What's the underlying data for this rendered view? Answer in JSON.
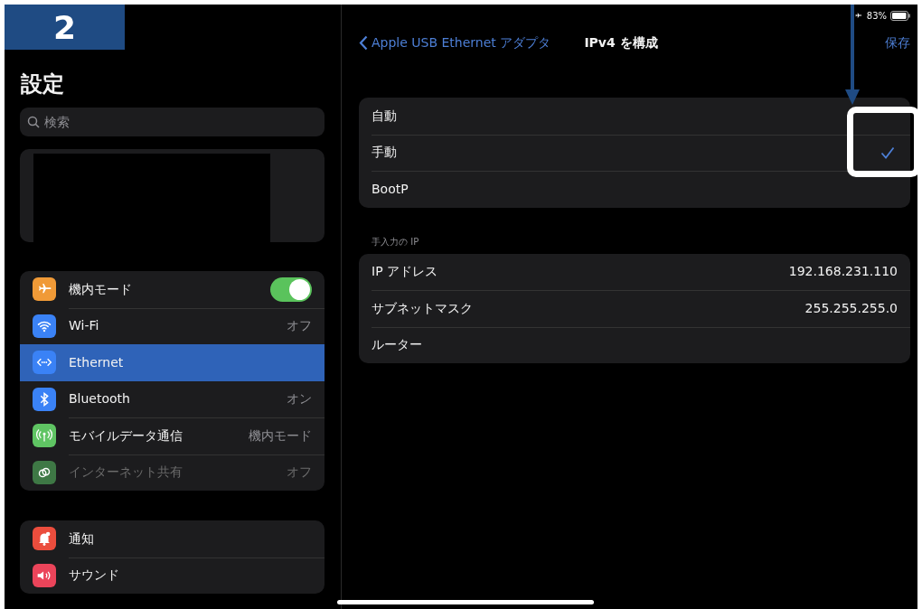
{
  "badge": {
    "text": "2"
  },
  "status_bar": {
    "airplane_mode": true,
    "battery": "83%"
  },
  "sidebar": {
    "title": "設定",
    "search": {
      "placeholder": "検索"
    },
    "groups": [
      {
        "kind": "profile"
      },
      {
        "kind": "list",
        "items": [
          {
            "label": "機内モード",
            "color": "#f09a37",
            "kind": "toggle",
            "on": true,
            "selected": false,
            "disabled": false
          },
          {
            "label": "Wi-Fi",
            "color": "#3a82f6",
            "kind": "value",
            "value": "オフ",
            "selected": false,
            "disabled": false
          },
          {
            "label": "Ethernet",
            "color": "#3a82f6",
            "kind": "plain",
            "selected": true,
            "disabled": false
          },
          {
            "label": "Bluetooth",
            "color": "#3a82f6",
            "kind": "value",
            "value": "オン",
            "selected": false,
            "disabled": false
          },
          {
            "label": "モバイルデータ通信",
            "color": "#5fc463",
            "kind": "value",
            "value": "機内モード",
            "selected": false,
            "disabled": false
          },
          {
            "label": "インターネット共有",
            "color": "#3e7845",
            "kind": "value",
            "value": "オフ",
            "selected": false,
            "disabled": true
          }
        ]
      },
      {
        "kind": "list",
        "items": [
          {
            "label": "通知",
            "color": "#eb4d3d",
            "kind": "plain",
            "selected": false,
            "disabled": false
          },
          {
            "label": "サウンド",
            "color": "#eb445a",
            "kind": "plain",
            "selected": false,
            "disabled": false
          }
        ]
      }
    ]
  },
  "detail": {
    "nav": {
      "back": "Apple USB Ethernet アダプタ",
      "title": "IPv4 を構成",
      "action": "保存"
    },
    "options": [
      {
        "label": "自動",
        "selected": false
      },
      {
        "label": "手動",
        "selected": true
      },
      {
        "label": "BootP",
        "selected": false
      }
    ],
    "manual_section": {
      "header": "手入力の IP",
      "fields": [
        {
          "label": "IP アドレス",
          "value": "192.168.231.110"
        },
        {
          "label": "サブネットマスク",
          "value": "255.255.255.0"
        },
        {
          "label": "ルーター"
        }
      ]
    }
  }
}
